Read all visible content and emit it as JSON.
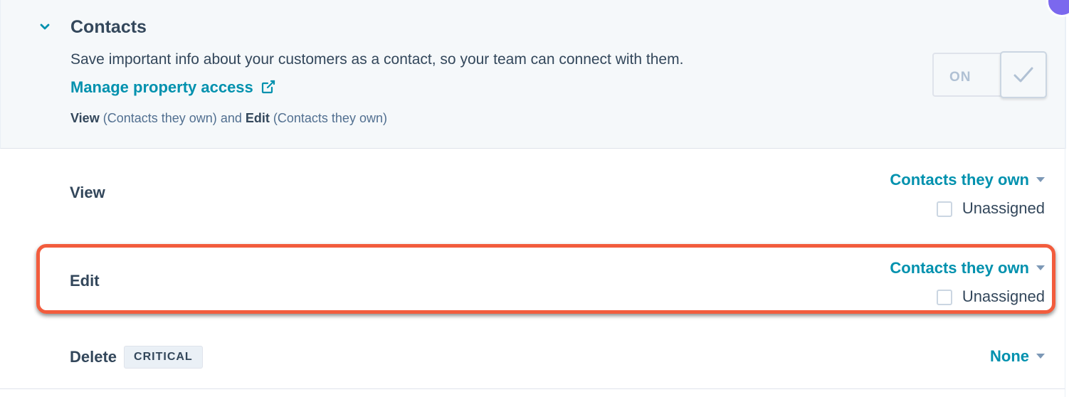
{
  "section": {
    "title": "Contacts",
    "description": "Save important info about your customers as a contact, so your team can connect with them.",
    "manage_link": "Manage property access",
    "summary": {
      "view_label": "View",
      "view_scope": "(Contacts they own)",
      "and": "and",
      "edit_label": "Edit",
      "edit_scope": "(Contacts they own)"
    },
    "toggle": {
      "label": "ON",
      "state": "on"
    }
  },
  "permissions": [
    {
      "label": "View",
      "value": "Contacts they own",
      "checkbox_label": "Unassigned",
      "checked": false
    },
    {
      "label": "Edit",
      "value": "Contacts they own",
      "checkbox_label": "Unassigned",
      "checked": false
    },
    {
      "label": "Delete",
      "badge": "CRITICAL",
      "value": "None"
    }
  ],
  "colors": {
    "accent": "#0091ae",
    "text": "#33475b",
    "highlight": "#f25c3d",
    "header_bg": "#f5f8fa"
  },
  "icons": {
    "collapse": "chevron-down-icon",
    "external": "external-link-icon",
    "toggle_check": "check-icon",
    "dropdown": "caret-down-icon"
  }
}
